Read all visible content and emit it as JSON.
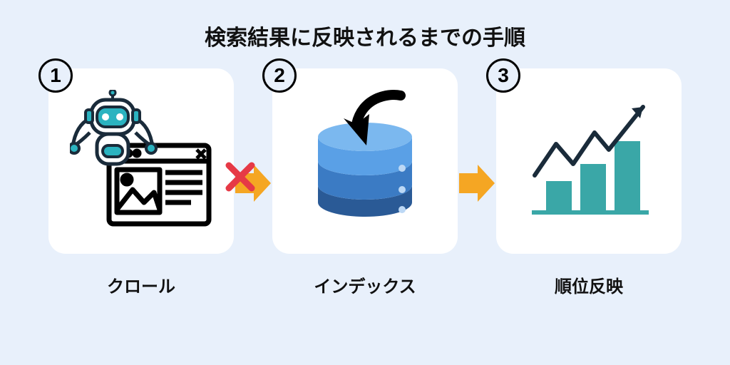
{
  "title": "検索結果に反映されるまでの手順",
  "steps": [
    {
      "num": "1",
      "label": "クロール",
      "icon": "robot-crawl-webpage"
    },
    {
      "num": "2",
      "label": "インデックス",
      "icon": "database-index"
    },
    {
      "num": "3",
      "label": "順位反映",
      "icon": "ranking-chart"
    }
  ],
  "arrows": [
    {
      "kind": "blocked",
      "color": "#f5a623"
    },
    {
      "kind": "arrow",
      "color": "#f5a623"
    }
  ],
  "colors": {
    "bg": "#e8f0fb",
    "card": "#ffffff",
    "arrow": "#f5a623",
    "cross": "#e63946",
    "db_top": "#5aa0e6",
    "db_mid": "#3b7bc4",
    "db_bot": "#2a5a96",
    "chart": "#3aa7a7",
    "robot": "#2bb3c0"
  }
}
